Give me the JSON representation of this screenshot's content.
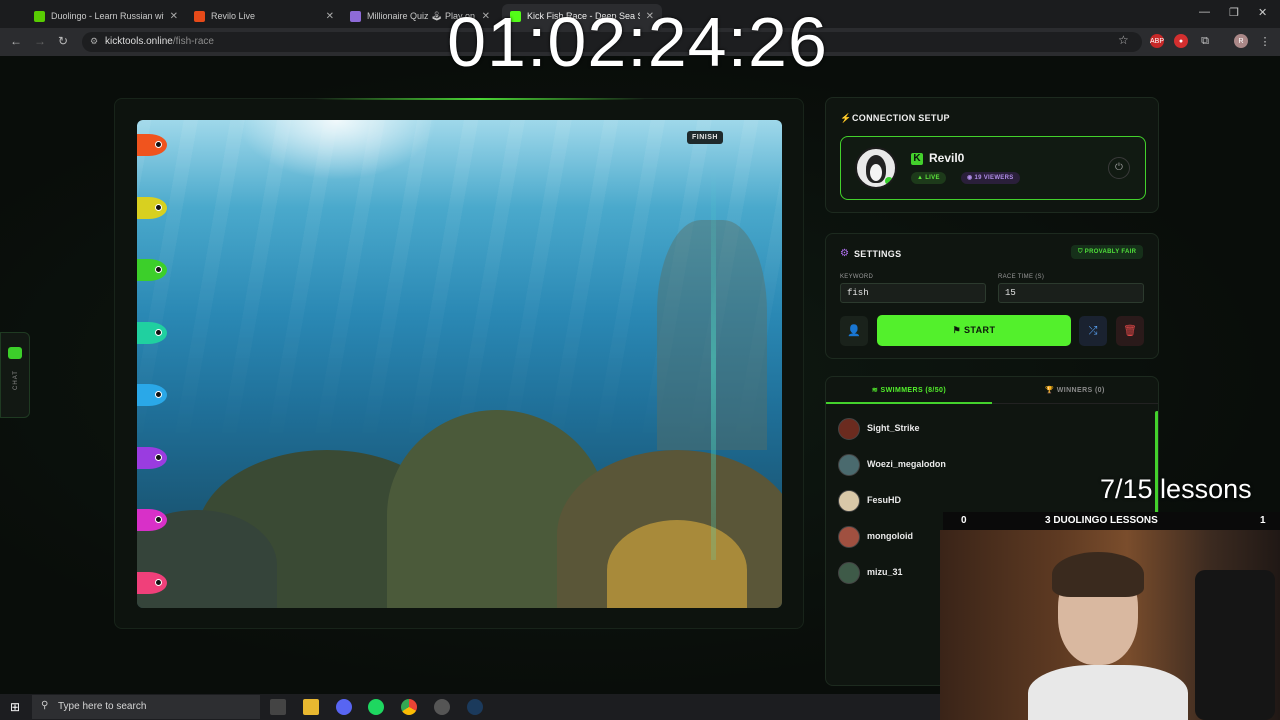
{
  "browser": {
    "tabs": [
      {
        "label": "Duolingo - Learn Russian with l",
        "icon_color": "#58cc02",
        "active": false
      },
      {
        "label": "Revilo Live",
        "icon_color": "#e64a19",
        "active": false
      },
      {
        "label": "Millionaire Quiz 🕹 Play on",
        "icon_color": "#8e6bd8",
        "active": false
      },
      {
        "label": "Kick Fish Race - Deep Sea Show",
        "icon_color": "#53fc18",
        "active": true
      }
    ],
    "url_host": "kicktools.online",
    "url_path": "/fish-race"
  },
  "overlay": {
    "timer": "01:02:24:26",
    "lessons_text": "7/15 lessons",
    "duo_left": "0",
    "duo_title": "3 DUOLINGO LESSONS",
    "duo_right": "1"
  },
  "sidebar": {
    "chat_label": "CHAT"
  },
  "game": {
    "finish_label": "FINISH"
  },
  "connection": {
    "title": "CONNECTION SETUP",
    "streamer_name": "Revil0",
    "live_label": "LIVE",
    "viewers_label": "19 VIEWERS"
  },
  "settings": {
    "title": "SETTINGS",
    "badge": "PROVABLY FAIR",
    "keyword_label": "KEYWORD",
    "keyword_value": "fish",
    "race_time_label": "RACE TIME (S)",
    "race_time_value": "15",
    "start_label": "START"
  },
  "swimmers": {
    "tab_swimmers": "SWIMMERS (8/50)",
    "tab_winners": "WINNERS (0)",
    "list": [
      {
        "name": "Sight_Strike",
        "avatar_color": "#6b2b1f"
      },
      {
        "name": "Woezi_megalodon",
        "avatar_color": "#4a6a6e"
      },
      {
        "name": "FesuHD",
        "avatar_color": "#d9c8a8"
      },
      {
        "name": "mongoloid",
        "avatar_color": "#a05040"
      },
      {
        "name": "mizu_31",
        "avatar_color": "#3e5a48"
      }
    ]
  },
  "race_fish_colors": [
    "#f0541e",
    "#d8d020",
    "#3ccf2a",
    "#20d0a0",
    "#2aa8e8",
    "#9a3ce0",
    "#d830c8",
    "#f0407a"
  ],
  "taskbar": {
    "search_placeholder": "Type here to search"
  },
  "colors": {
    "accent": "#53f02c",
    "bg": "#0a0e0b"
  }
}
